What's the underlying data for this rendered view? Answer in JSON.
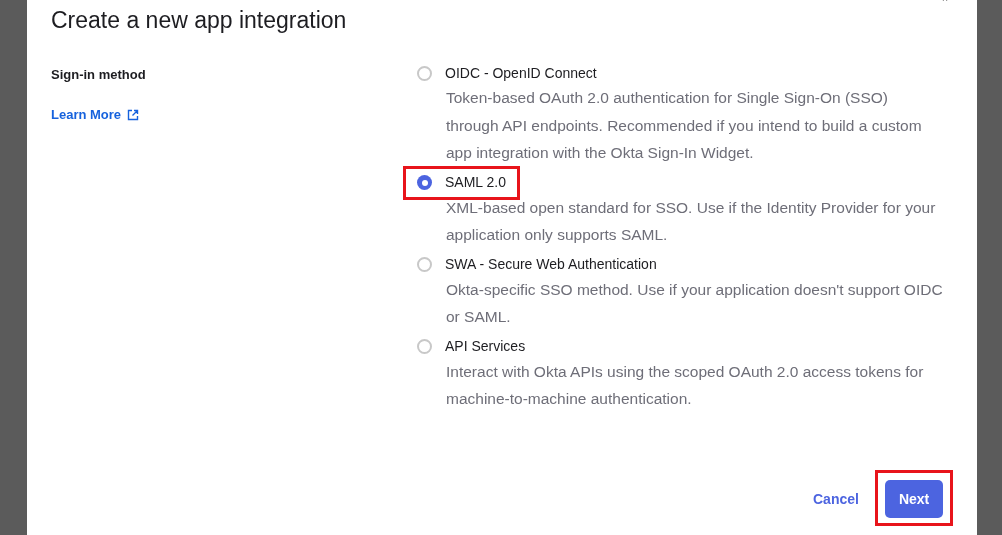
{
  "dialog": {
    "title": "Create a new app integration",
    "section_label": "Sign-in method",
    "learn_more": "Learn More"
  },
  "options": [
    {
      "label": "OIDC - OpenID Connect",
      "description": "Token-based OAuth 2.0 authentication for Single Sign-On (SSO) through API endpoints. Recommended if you intend to build a custom app integration with the Okta Sign-In Widget.",
      "selected": false,
      "highlighted": false
    },
    {
      "label": "SAML 2.0",
      "description": "XML-based open standard for SSO. Use if the Identity Provider for your application only supports SAML.",
      "selected": true,
      "highlighted": true
    },
    {
      "label": "SWA - Secure Web Authentication",
      "description": "Okta-specific SSO method. Use if your application doesn't support OIDC or SAML.",
      "selected": false,
      "highlighted": false
    },
    {
      "label": "API Services",
      "description": "Interact with Okta APIs using the scoped OAuth 2.0 access tokens for machine-to-machine authentication.",
      "selected": false,
      "highlighted": false
    }
  ],
  "buttons": [
    {
      "label": "Cancel",
      "kind": "link",
      "highlighted": false
    },
    {
      "label": "Next",
      "kind": "primary",
      "highlighted": true
    }
  ]
}
